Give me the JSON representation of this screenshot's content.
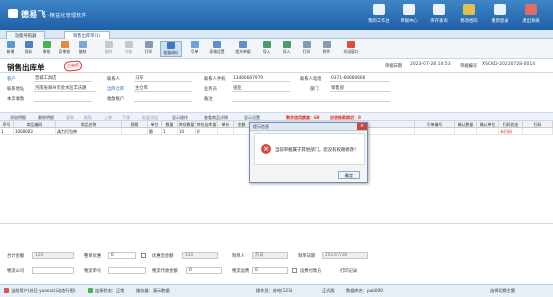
{
  "app": {
    "brand": "德易飞",
    "subtitle": "·精益化管理软件",
    "accent": "#2a6fb5"
  },
  "top_tools": [
    {
      "label": "我的工作台",
      "icon": "desk-icon"
    },
    {
      "label": "单据中心",
      "icon": "document-icon"
    },
    {
      "label": "库存查询",
      "icon": "warehouse-icon"
    },
    {
      "label": "修改密码",
      "icon": "key-icon"
    },
    {
      "label": "重新登录",
      "icon": "user-icon"
    },
    {
      "label": "退出系统",
      "icon": "power-icon"
    }
  ],
  "tabs": [
    {
      "label": "功能导航器"
    },
    {
      "label": "销售出库单(1)"
    }
  ],
  "toolbar": [
    {
      "label": "新增",
      "state": "on"
    },
    {
      "label": "保存",
      "state": "on"
    },
    {
      "label": "审核",
      "state": "on"
    },
    {
      "label": "反审核",
      "state": "on"
    },
    {
      "label": "复制",
      "state": "on"
    },
    {
      "label": "删除",
      "state": "off"
    },
    {
      "label": "作废",
      "state": "off"
    },
    {
      "label": "打印",
      "state": "on"
    },
    {
      "label": "批量调价",
      "state": "hl"
    },
    {
      "label": "引单",
      "state": "on"
    },
    {
      "label": "表格设置",
      "state": "on"
    },
    {
      "label": "相关单据",
      "state": "on"
    },
    {
      "label": "导入",
      "state": "on"
    },
    {
      "label": "导入",
      "state": "on"
    },
    {
      "label": "打印",
      "state": "on"
    },
    {
      "label": "附件",
      "state": "on"
    },
    {
      "label": "关闭窗口",
      "state": "close"
    }
  ],
  "doc": {
    "title": "销售出库单",
    "stamp": "已审核",
    "date_label": "单据日期",
    "date": "2023-07-28 14:53",
    "no_label": "单据编号",
    "no": "XSCKD-20230728-0014"
  },
  "form": {
    "customer_label": "客户",
    "customer": "晋城工具店",
    "contact_label": "联系人",
    "contact": "马军",
    "phone_label": "联系人手机",
    "phone": "13466667970",
    "tel_label": "联系人电话",
    "tel": "0371-66666666",
    "address_label": "联系地址",
    "address": "河南省郑州市金水区丰庆路",
    "warehouse_label": "出库仓库",
    "warehouse": "主仓库",
    "clerk_label": "业务员",
    "clerk": "张亚",
    "dept_label": "部门",
    "dept": "销售部",
    "receipt_label": "本次收款",
    "receipt": "",
    "account_label": "收款账户",
    "account": "",
    "remark_label": "备注",
    "remark": ""
  },
  "line_toolbar": {
    "items": [
      "添加明细",
      "删除明细",
      "复制",
      "粘贴",
      "上移",
      "下移",
      "批量添加",
      "显示操作",
      "查看商品详情",
      "显示设置"
    ],
    "credit_label": "剩余信用额度：60",
    "debt_label": "应收账款期初：0"
  },
  "grid": {
    "headers": [
      "序号",
      "商品编码",
      "商品名称",
      "规格",
      "单位",
      "数量",
      "库存数量",
      "库存出库量",
      "单价",
      "金额",
      "",
      "",
      "",
      "",
      "",
      "引单编号",
      "确认数量",
      "确认单位",
      "扫码状态",
      "扫码"
    ],
    "row": [
      "1",
      "1000003",
      "清力打包带",
      "",
      "跟",
      "1",
      "10",
      "0",
      "",
      "",
      "",
      "",
      "",
      "",
      "",
      "",
      "",
      "",
      "未扫码",
      ""
    ]
  },
  "dialog": {
    "title": "提示信息",
    "message": "当前单据属于其他部门，您没有权限修改！",
    "ok": "确定"
  },
  "footer": {
    "total_label": "合计金额",
    "total": "120",
    "discount_label": "整单优惠",
    "discount": "0",
    "after_label": "优惠后金额",
    "after": "120",
    "maker_label": "制单人",
    "maker": "苏日",
    "made_label": "制单日期",
    "made": "2023/7/28",
    "logistics_label": "物流公司",
    "logistics": "",
    "waybill_label": "物流单号",
    "waybill": "",
    "fee_label": "物流代收金额",
    "fee": "0",
    "freight_label": "物流运费",
    "freight": "0",
    "payer_label": "运费付款方",
    "payer": "",
    "print_label": "打印记录"
  },
  "status": {
    "user": "当前用户(苏日 yuansz)(动态行图)",
    "conn": "连接状态：正常",
    "server": "服务器：演示数据",
    "operator": "操作员：苏哈(123)",
    "version": "正式版",
    "db": "数据库名：pub000",
    "theme": "选择切换主题"
  }
}
